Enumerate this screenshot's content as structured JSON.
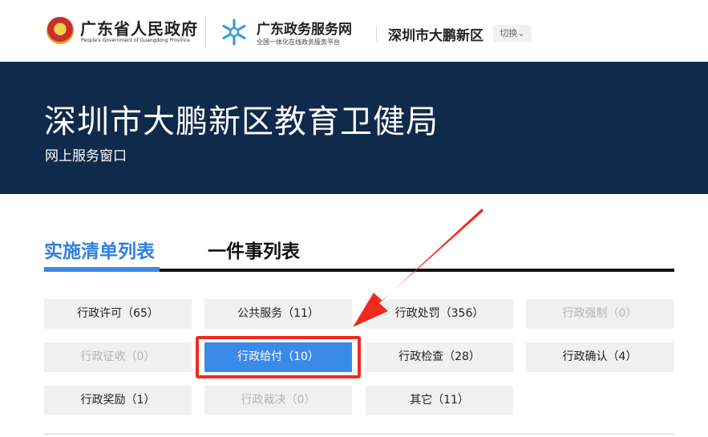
{
  "header": {
    "gov_name": "广东省人民政府",
    "gov_subtitle": "People's Government of Guangdong Province",
    "service_name": "广东政务服务网",
    "service_subtitle": "全国一体化在线政务服务平台",
    "region": "深圳市大鹏新区",
    "switch_label": "切换"
  },
  "banner": {
    "title": "深圳市大鹏新区教育卫健局",
    "subtitle": "网上服务窗口"
  },
  "tabs": [
    {
      "label": "实施清单列表",
      "active": true
    },
    {
      "label": "一件事列表",
      "active": false
    }
  ],
  "categories": [
    {
      "label": "行政许可（65）",
      "state": "normal"
    },
    {
      "label": "公共服务（11）",
      "state": "normal"
    },
    {
      "label": "行政处罚（356）",
      "state": "normal"
    },
    {
      "label": "行政强制（0）",
      "state": "disabled"
    },
    {
      "label": "行政征收（0）",
      "state": "disabled"
    },
    {
      "label": "行政给付（10）",
      "state": "selected"
    },
    {
      "label": "行政检查（28）",
      "state": "normal"
    },
    {
      "label": "行政确认（4）",
      "state": "normal"
    },
    {
      "label": "行政奖励（1）",
      "state": "normal"
    },
    {
      "label": "行政裁决（0）",
      "state": "disabled"
    },
    {
      "label": "其它（11）",
      "state": "normal"
    }
  ],
  "colors": {
    "banner_bg": "#0f2a4a",
    "accent": "#3a8be8",
    "annotation": "#ee2b1e"
  }
}
